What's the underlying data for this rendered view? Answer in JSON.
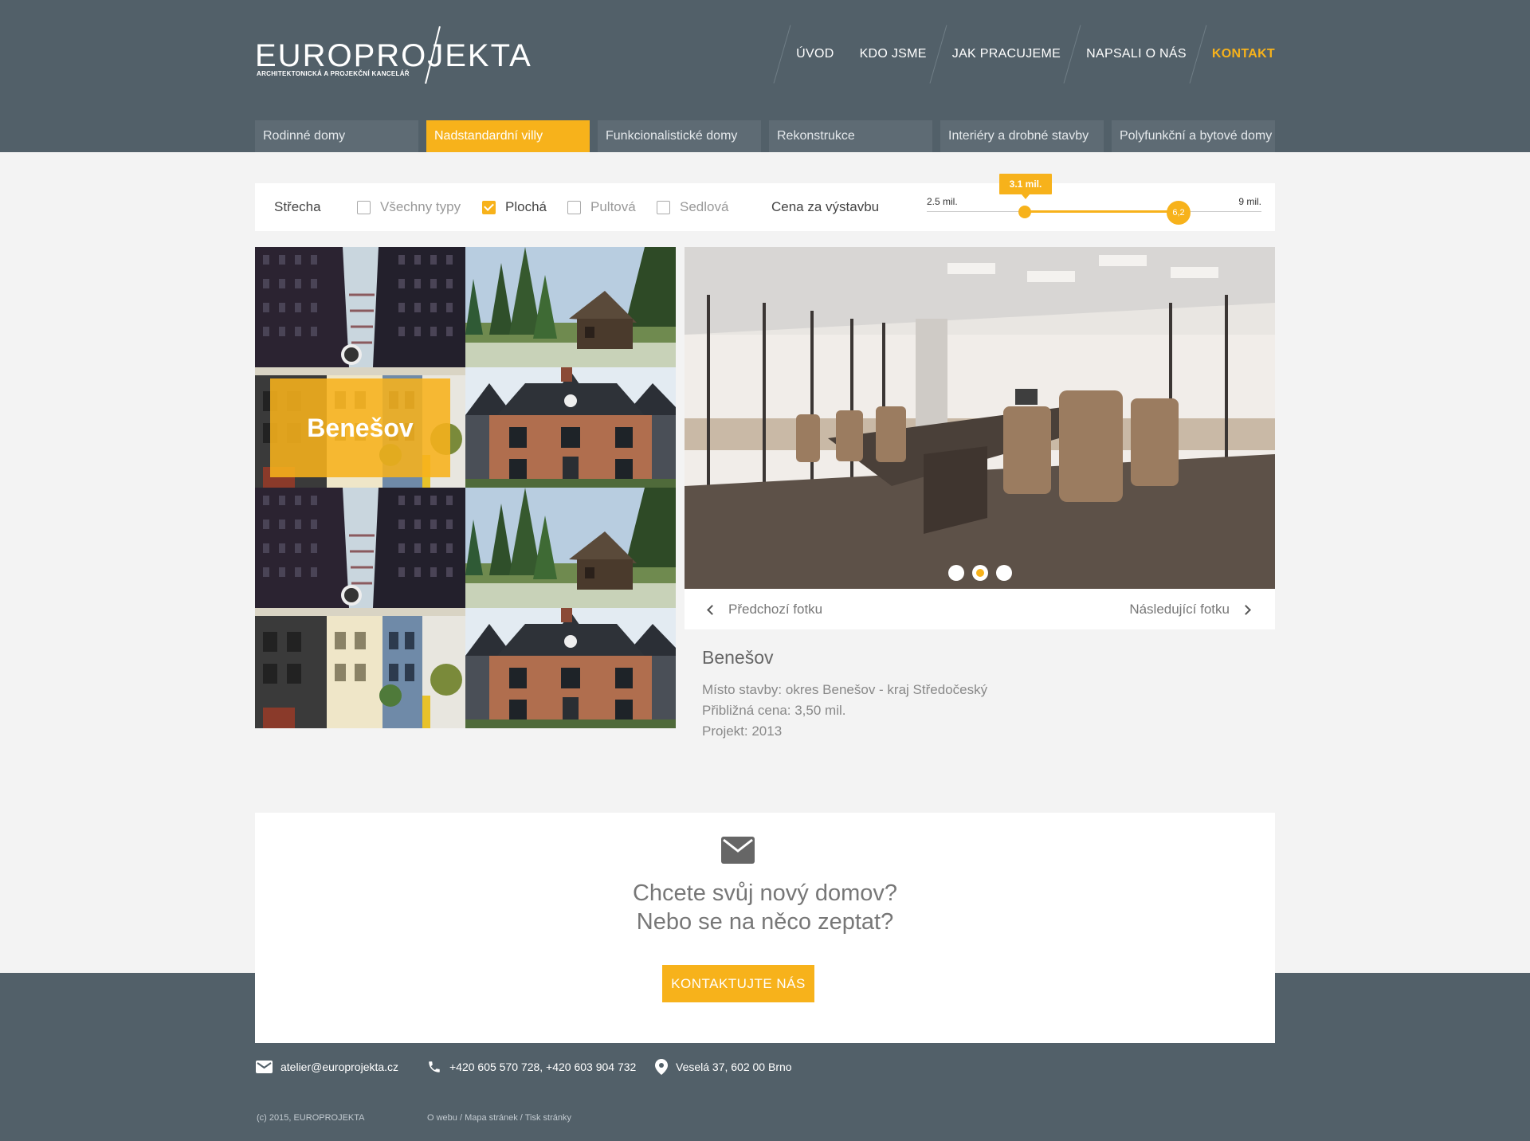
{
  "brand": {
    "logo_text": "EUROPROJEKTA",
    "logo_sub": "ARCHITEKTONICKÁ A PROJEKČNÍ KANCELÁŘ"
  },
  "colors": {
    "accent": "#f7b21b",
    "header_bg": "#526069",
    "tab_bg": "#5e6b74",
    "page_bg": "#f3f3f3"
  },
  "topnav": [
    {
      "label": "ÚVOD",
      "active": false
    },
    {
      "label": "KDO JSME",
      "active": false
    },
    {
      "label": "JAK PRACUJEME",
      "active": false
    },
    {
      "label": "NAPSALI O NÁS",
      "active": false
    },
    {
      "label": "KONTAKT",
      "active": true
    }
  ],
  "categories": [
    {
      "label": "Rodinné domy",
      "active": false
    },
    {
      "label": "Nadstandardní villy",
      "active": true
    },
    {
      "label": "Funkcionalistické domy",
      "active": false
    },
    {
      "label": "Rekonstrukce",
      "active": false
    },
    {
      "label": "Interiéry a drobné stavby",
      "active": false
    },
    {
      "label": "Polyfunkční a bytové domy",
      "active": false
    }
  ],
  "filter": {
    "roof_label": "Střecha",
    "roof_options": [
      {
        "label": "Všechny typy",
        "checked": false
      },
      {
        "label": "Plochá",
        "checked": true
      },
      {
        "label": "Pultová",
        "checked": false
      },
      {
        "label": "Sedlová",
        "checked": false
      }
    ],
    "price_label": "Cena za výstavbu",
    "price_min_label": "2.5 mil.",
    "price_max_label": "9 mil.",
    "price_selected_min": "3.1 mil.",
    "price_selected_max": "6,2"
  },
  "gallery": {
    "tiles": [
      {
        "image": "skyscraper-photo"
      },
      {
        "image": "forest-cabin-photo"
      },
      {
        "image": "rowhouses-photo",
        "overlay": "Benešov"
      },
      {
        "image": "brick-house-photo"
      },
      {
        "image": "skyscraper-photo"
      },
      {
        "image": "forest-cabin-photo"
      },
      {
        "image": "rowhouses-photo"
      },
      {
        "image": "brick-house-photo"
      }
    ]
  },
  "detail": {
    "photo": "conference-room-photo",
    "dots": [
      false,
      true,
      false
    ],
    "prev_label": "Předchozí fotku",
    "next_label": "Následující fotku",
    "title": "Benešov",
    "lines": [
      "Místo stavby: okres Benešov - kraj Středočeský",
      "Přibližná cena: 3,50 mil.",
      "Projekt: 2013"
    ]
  },
  "cta": {
    "icon": "envelope-icon",
    "line1": "Chcete svůj nový domov?",
    "line2": "Nebo se na něco zeptat?",
    "button": "KONTAKTUJTE NÁS"
  },
  "footer": {
    "email": "atelier@europrojekta.cz",
    "phone": "+420 605 570 728, +420 603 904 732",
    "address": "Veselá 37, 602 00 Brno",
    "copyright": "(c) 2015, EUROPROJEKTA",
    "links": [
      "O webu",
      "Mapa stránek",
      "Tisk stránky"
    ]
  }
}
